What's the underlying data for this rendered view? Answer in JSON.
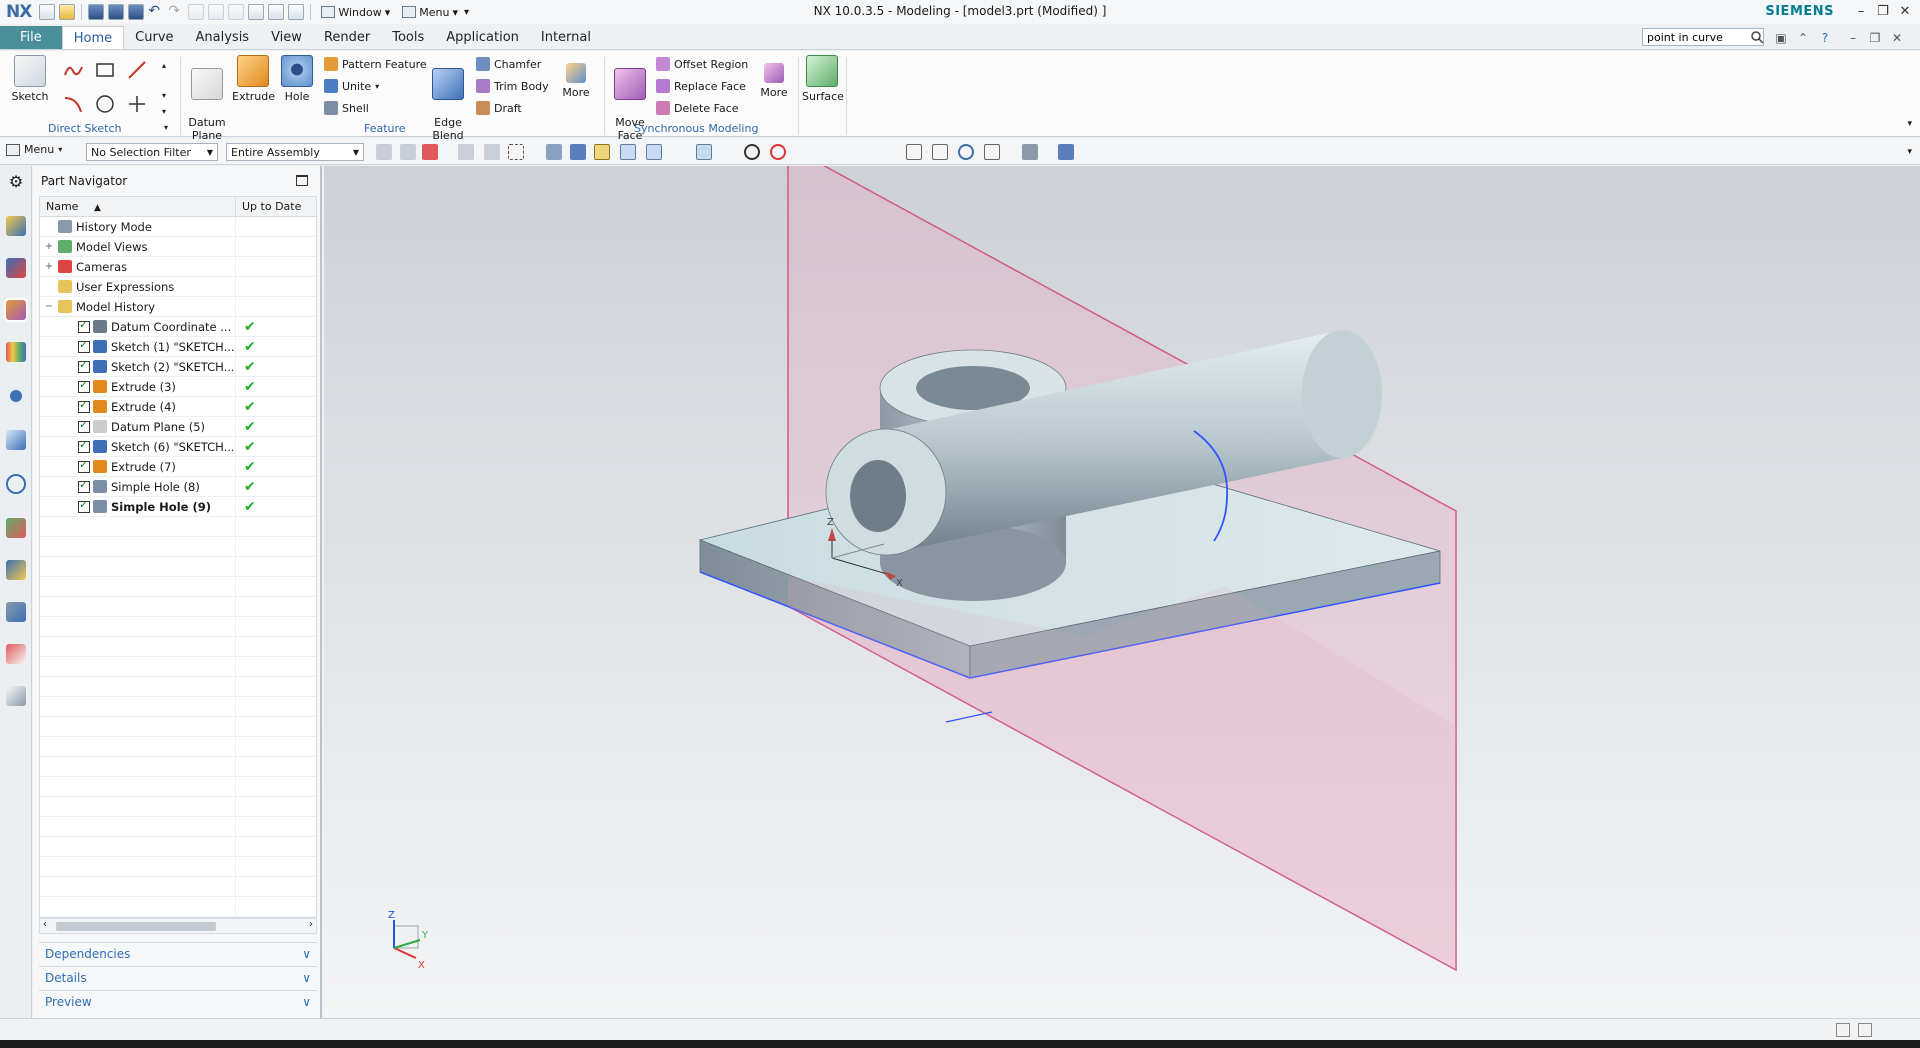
{
  "app": {
    "logo": "NX",
    "window_title": "NX 10.0.3.5 - Modeling - [model3.prt (Modified) ]",
    "brand": "SIEMENS",
    "quick_menus": [
      "Window",
      "Menu"
    ]
  },
  "ribbon_tabs": [
    "File",
    "Home",
    "Curve",
    "Analysis",
    "View",
    "Render",
    "Tools",
    "Application",
    "Internal"
  ],
  "active_tab": "Home",
  "command_search": {
    "value": "point in curve"
  },
  "ribbon": {
    "sketch_label": "Sketch",
    "direct_sketch_label": "Direct Sketch",
    "feature_label": "Feature",
    "sync_label": "Synchronous Modeling",
    "datum_plane": "Datum\nPlane",
    "extrude": "Extrude",
    "hole": "Hole",
    "pattern_feature": "Pattern Feature",
    "unite": "Unite",
    "shell": "Shell",
    "edge_blend": "Edge\nBlend",
    "chamfer": "Chamfer",
    "trim_body": "Trim Body",
    "draft": "Draft",
    "more": "More",
    "move_face": "Move\nFace",
    "offset_region": "Offset Region",
    "replace_face": "Replace Face",
    "delete_face": "Delete Face",
    "more2": "More",
    "surface": "Surface"
  },
  "toolbar2": {
    "menu_label": "Menu",
    "selection_filter": "No Selection Filter",
    "assembly_scope": "Entire Assembly"
  },
  "navigator": {
    "title": "Part Navigator",
    "col_name": "Name",
    "col_uptodate": "Up to Date",
    "rows": [
      {
        "label": "History Mode",
        "level": 1,
        "checkbox": false,
        "uptodate": false,
        "bold": false,
        "expander": ""
      },
      {
        "label": "Model Views",
        "level": 1,
        "checkbox": false,
        "uptodate": false,
        "bold": false,
        "expander": "+"
      },
      {
        "label": "Cameras",
        "level": 1,
        "checkbox": false,
        "uptodate": false,
        "bold": false,
        "expander": "+"
      },
      {
        "label": "User Expressions",
        "level": 1,
        "checkbox": false,
        "uptodate": false,
        "bold": false,
        "expander": ""
      },
      {
        "label": "Model History",
        "level": 1,
        "checkbox": false,
        "uptodate": false,
        "bold": false,
        "expander": "−"
      },
      {
        "label": "Datum Coordinate ...",
        "level": 2,
        "checkbox": true,
        "uptodate": true,
        "bold": false,
        "expander": ""
      },
      {
        "label": "Sketch (1) \"SKETCH...",
        "level": 2,
        "checkbox": true,
        "uptodate": true,
        "bold": false,
        "expander": ""
      },
      {
        "label": "Sketch (2) \"SKETCH...",
        "level": 2,
        "checkbox": true,
        "uptodate": true,
        "bold": false,
        "expander": ""
      },
      {
        "label": "Extrude (3)",
        "level": 2,
        "checkbox": true,
        "uptodate": true,
        "bold": false,
        "expander": ""
      },
      {
        "label": "Extrude (4)",
        "level": 2,
        "checkbox": true,
        "uptodate": true,
        "bold": false,
        "expander": ""
      },
      {
        "label": "Datum Plane (5)",
        "level": 2,
        "checkbox": true,
        "uptodate": true,
        "bold": false,
        "expander": ""
      },
      {
        "label": "Sketch (6) \"SKETCH...",
        "level": 2,
        "checkbox": true,
        "uptodate": true,
        "bold": false,
        "expander": ""
      },
      {
        "label": "Extrude (7)",
        "level": 2,
        "checkbox": true,
        "uptodate": true,
        "bold": false,
        "expander": ""
      },
      {
        "label": "Simple Hole (8)",
        "level": 2,
        "checkbox": true,
        "uptodate": true,
        "bold": false,
        "expander": ""
      },
      {
        "label": "Simple Hole (9)",
        "level": 2,
        "checkbox": true,
        "uptodate": true,
        "bold": true,
        "expander": ""
      }
    ],
    "uptodate_mark": "✔",
    "panels": [
      "Dependencies",
      "Details",
      "Preview"
    ]
  },
  "viewport": {
    "axis_labels": {
      "z": "Z",
      "x": "X",
      "y": "Y"
    }
  },
  "colors": {
    "accent": "#2a5d9f",
    "file_tab": "#4a8f9a",
    "check_green": "#1ab02a",
    "datum_plane": "#e8a0b8",
    "edge_highlight": "#3355ff"
  }
}
